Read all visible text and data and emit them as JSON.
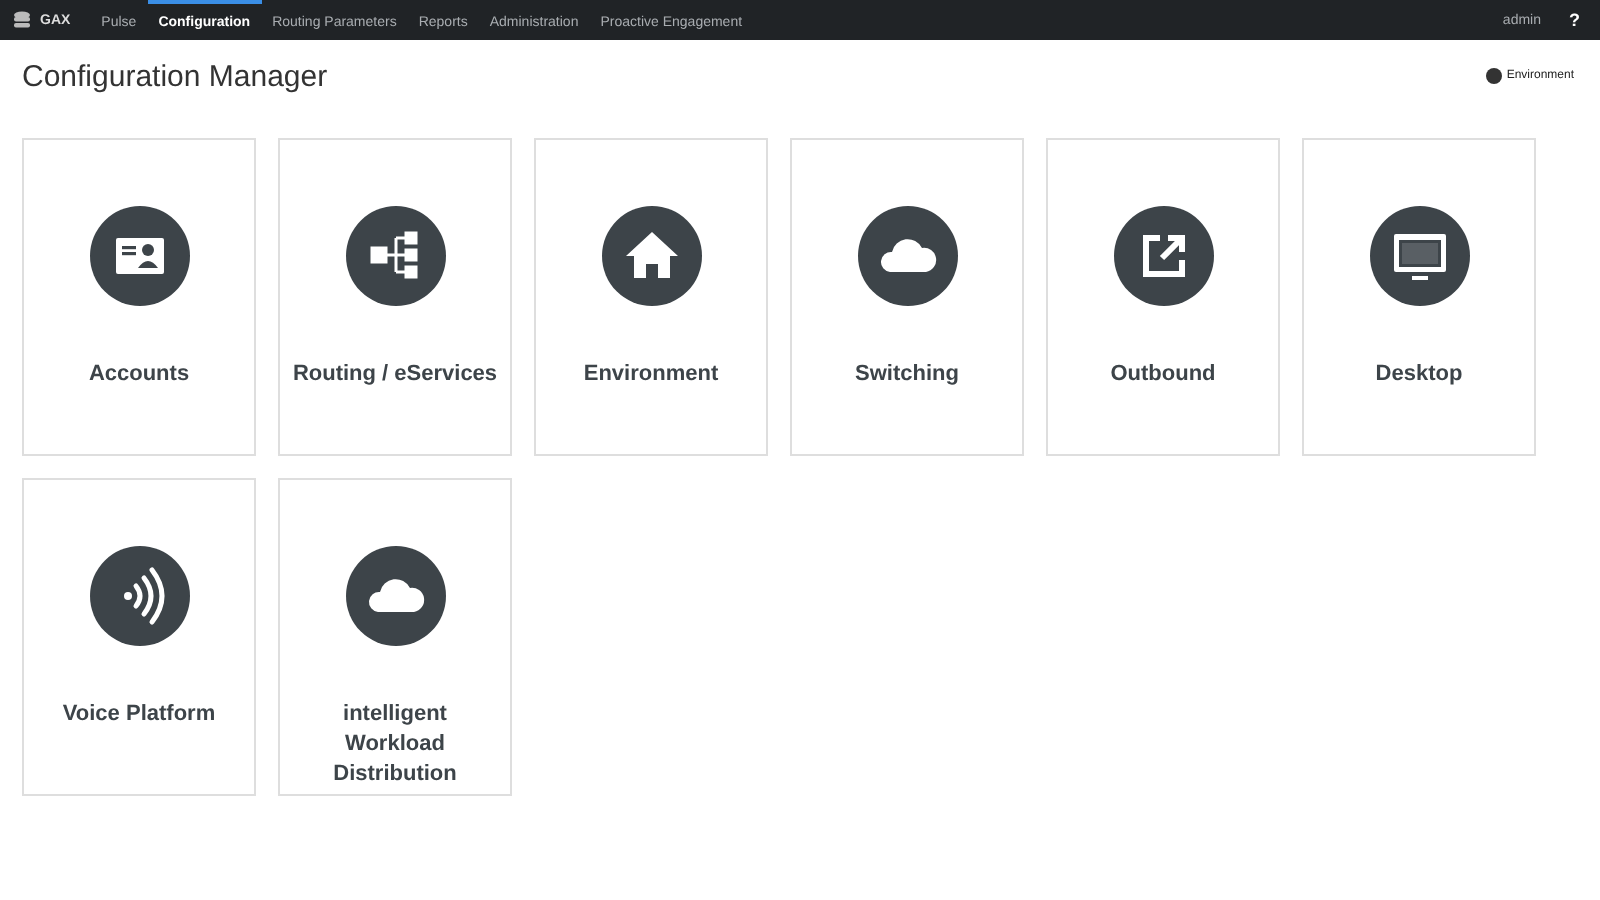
{
  "topbar": {
    "logo": "GAX",
    "nav": [
      {
        "label": "Pulse",
        "selected": false
      },
      {
        "label": "Configuration",
        "selected": true
      },
      {
        "label": "Routing Parameters",
        "selected": false
      },
      {
        "label": "Reports",
        "selected": false
      },
      {
        "label": "Administration",
        "selected": false
      },
      {
        "label": "Proactive Engagement",
        "selected": false
      }
    ],
    "user": "admin",
    "help": "?"
  },
  "page": {
    "title": "Configuration Manager",
    "environment": "Environment"
  },
  "tiles": [
    {
      "label": "Accounts",
      "kind": "card"
    },
    {
      "label": "Routing / eServices",
      "kind": "flow"
    },
    {
      "label": "Environment",
      "kind": "home"
    },
    {
      "label": "Switching",
      "kind": "cloud"
    },
    {
      "label": "Outbound",
      "kind": "export"
    },
    {
      "label": "Desktop",
      "kind": "monitor"
    },
    {
      "label": "Voice Platform",
      "kind": "signal"
    },
    {
      "label": "intelligent Workload Distribution",
      "kind": "cloud"
    }
  ]
}
